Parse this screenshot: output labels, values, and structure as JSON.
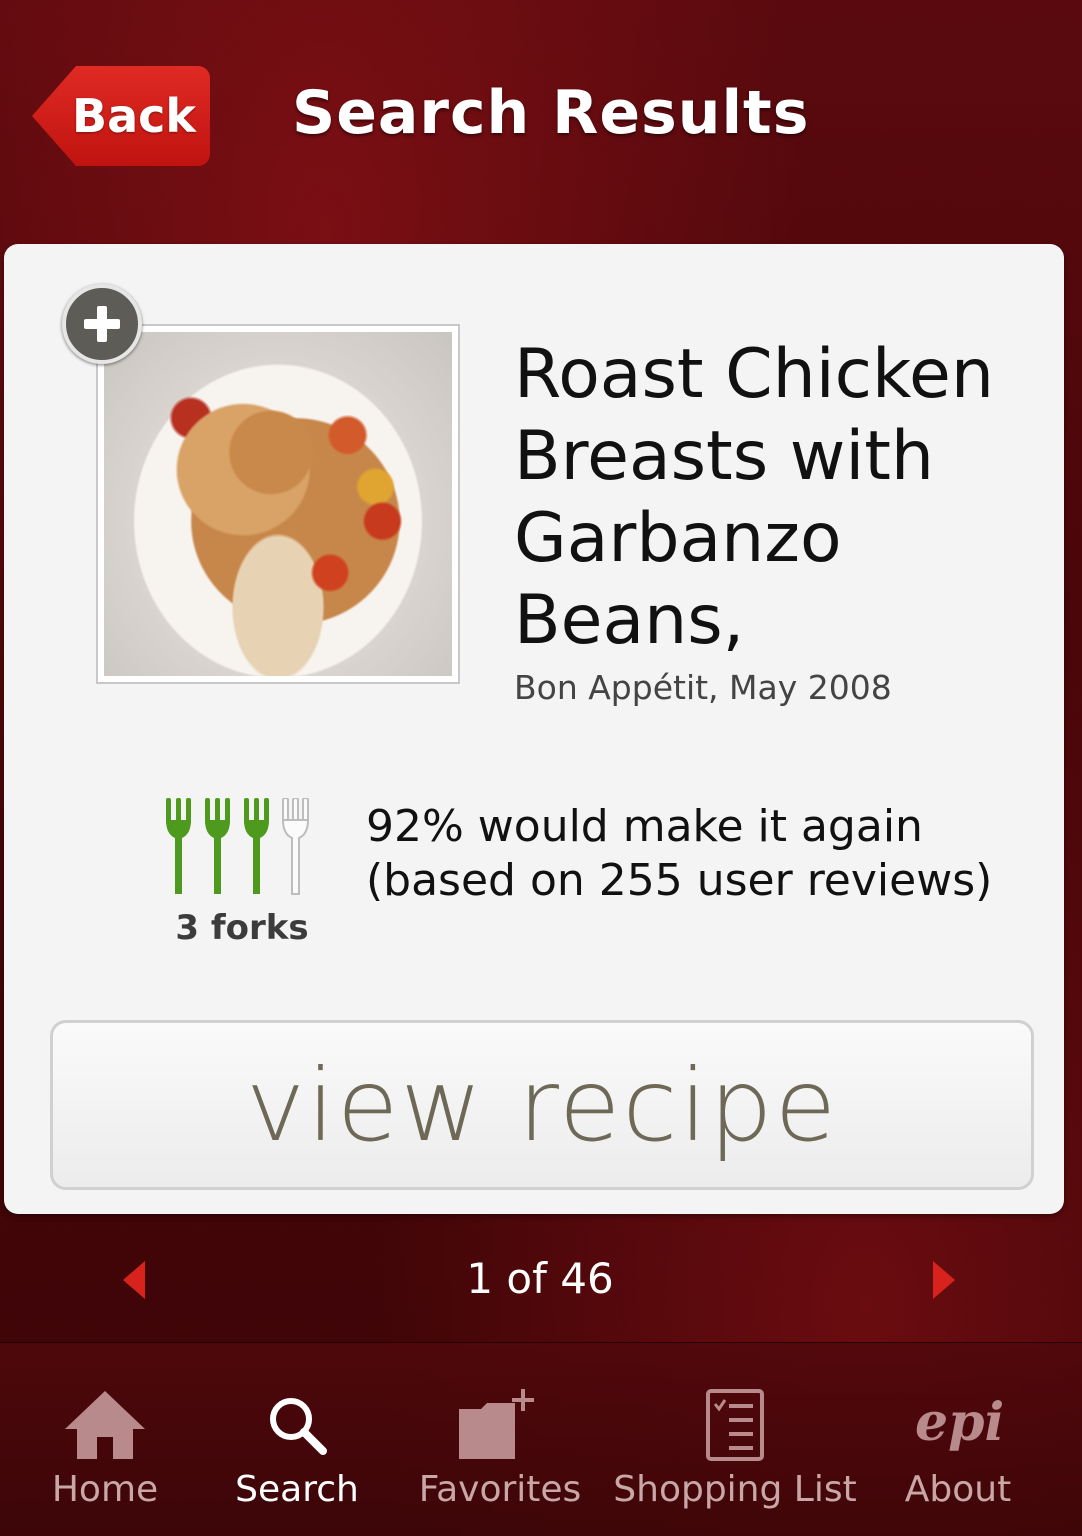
{
  "header": {
    "back_label": "Back",
    "title": "Search Results"
  },
  "recipe": {
    "title": "Roast Chicken Breasts with Garbanzo Beans,",
    "source": "Bon Appétit, May 2008",
    "rating": {
      "forks": 3,
      "max_forks": 4,
      "forks_label": "3 forks",
      "make_again_line1": "92% would make it again",
      "make_again_line2": "(based on 255 user reviews)"
    },
    "view_button_label": "view recipe"
  },
  "pager": {
    "text": "1 of 46"
  },
  "tabs": [
    {
      "label": "Home",
      "icon": "home-icon",
      "active": false
    },
    {
      "label": "Search",
      "icon": "search-icon",
      "active": true
    },
    {
      "label": "Favorites",
      "icon": "folder-plus-icon",
      "active": false
    },
    {
      "label": "Shopping List",
      "icon": "checklist-icon",
      "active": false
    },
    {
      "label": "About",
      "icon": "epi-logo-icon",
      "active": false
    }
  ],
  "colors": {
    "accent_red": "#d8231c",
    "fork_green": "#4e9a1f",
    "tab_inactive": "#c9a7a7"
  }
}
